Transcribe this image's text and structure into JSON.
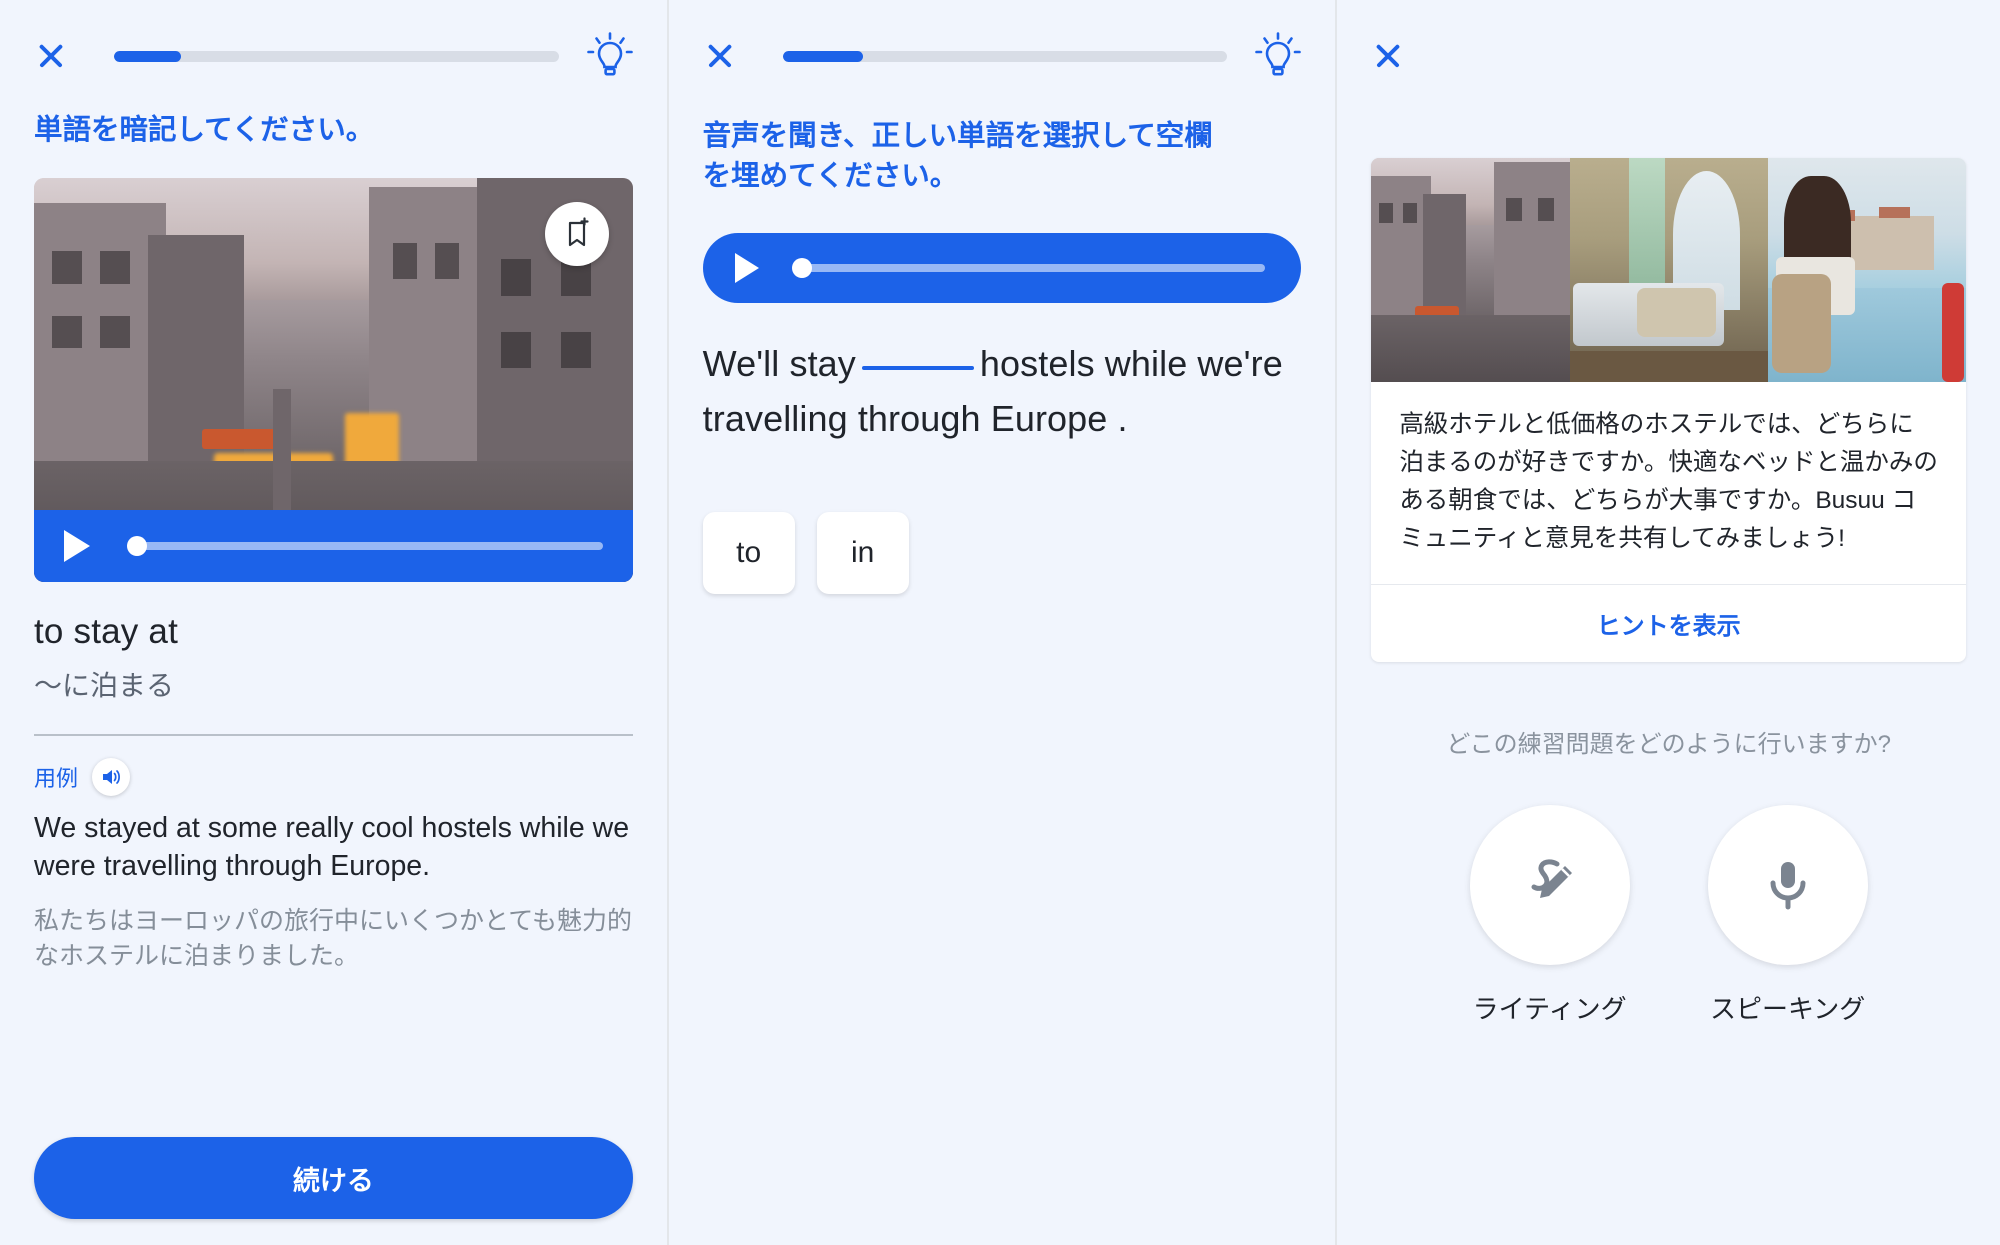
{
  "app": {
    "accent": "#1c62e8",
    "background": "#f1f5fd",
    "text": "#20242b",
    "muted": "#858e99"
  },
  "panel1": {
    "close_icon": "close-icon",
    "bulb_icon": "lightbulb-icon",
    "progress_percent": 15,
    "instruction": "単語を暗記してください。",
    "bookmark_icon": "bookmark-add-icon",
    "audio": {
      "play_icon": "play-icon",
      "position_percent": 2
    },
    "word_en": "to stay at",
    "word_ja": "〜に泊まる",
    "example_label": "用例",
    "speaker_icon": "speaker-icon",
    "example_en": "We stayed at some really cool hostels while we were travelling through Europe.",
    "example_ja": "私たちはヨーロッパの旅行中にいくつかとても魅力的なホステルに泊まりました。",
    "cta_label": "続ける"
  },
  "panel2": {
    "close_icon": "close-icon",
    "bulb_icon": "lightbulb-icon",
    "progress_percent": 18,
    "instruction": "音声を聞き、正しい単語を選択して空欄を埋めてください。",
    "audio": {
      "play_icon": "play-icon",
      "position_percent": 2
    },
    "cloze_before": "We'll stay",
    "cloze_after": "hostels while we're travelling through Europe",
    "cloze_end": ".",
    "options": [
      {
        "label": "to"
      },
      {
        "label": "in"
      }
    ]
  },
  "panel3": {
    "close_icon": "close-icon",
    "photos": [
      "paris-street-photo",
      "hotel-room-photo",
      "traveller-harbor-photo"
    ],
    "prompt_text": "高級ホテルと低価格のホステルでは、どちらに泊まるのが好きですか。快適なベッドと温かみのある朝食では、どちらが大事ですか。Busuu コミュニティと意見を共有してみましょう!",
    "hint_label": "ヒントを表示",
    "question": "どこの練習問題をどのように行いますか?",
    "modes": [
      {
        "label": "ライティング",
        "icon": "pencil-write-icon"
      },
      {
        "label": "スピーキング",
        "icon": "microphone-icon"
      }
    ]
  }
}
